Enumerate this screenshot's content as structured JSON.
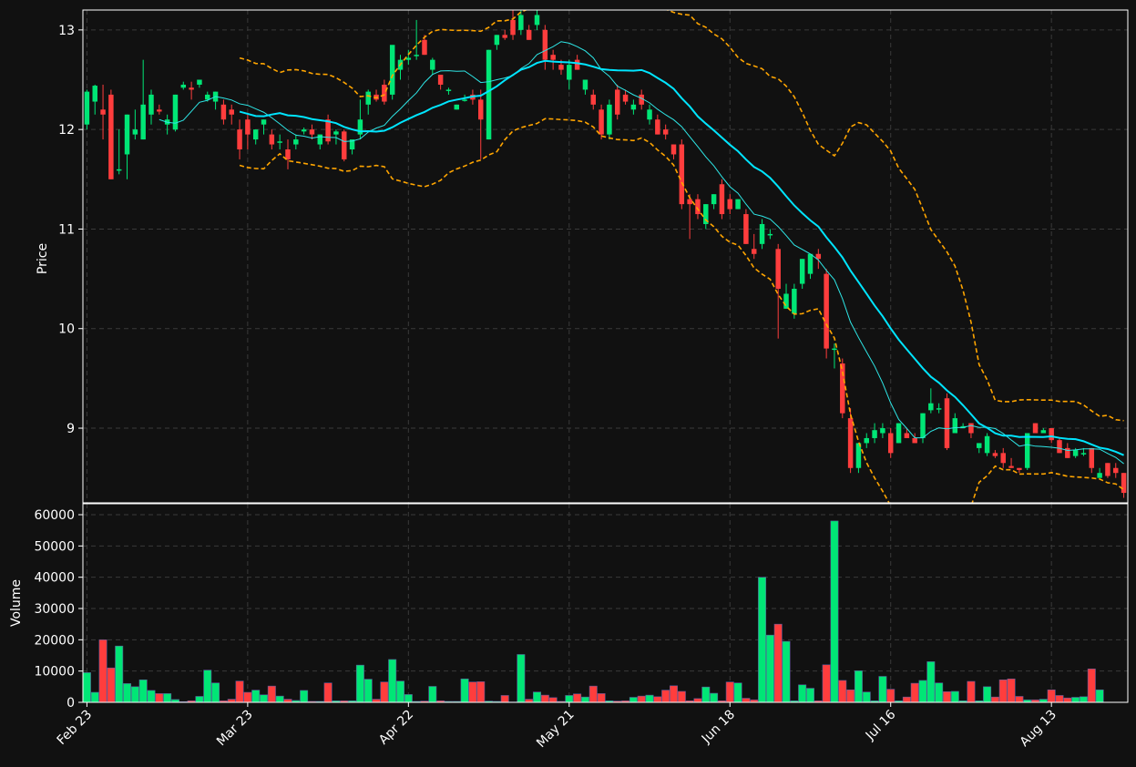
{
  "chart_data": [
    {
      "type": "candlestick",
      "ylabel": "Price",
      "ylim": [
        8.25,
        13.2
      ],
      "y_ticks": [
        "9",
        "10",
        "11",
        "12",
        "13"
      ],
      "x_tick_labels": [
        "Feb 23",
        "Mar 23",
        "Apr 22",
        "May 21",
        "Jun 18",
        "Jul 16",
        "Aug 13"
      ],
      "x_tick_indices": [
        0,
        20,
        40,
        60,
        80,
        100,
        120
      ],
      "grid": true,
      "colors": {
        "up": "#00e676",
        "down": "#ff3d3d",
        "ma_fast": "#2ee6e6",
        "ma_slow": "#00e5ff",
        "bands": "#ffa500",
        "background": "#111111",
        "grid": "#3a3a3a"
      },
      "ohlc": [
        [
          12.05,
          12.4,
          12.0,
          12.38
        ],
        [
          12.28,
          12.45,
          12.15,
          12.44
        ],
        [
          12.2,
          12.45,
          11.9,
          12.15
        ],
        [
          12.35,
          12.4,
          11.5,
          11.5
        ],
        [
          11.6,
          12.0,
          11.55,
          11.6
        ],
        [
          11.75,
          12.15,
          11.5,
          12.15
        ],
        [
          11.95,
          12.2,
          11.9,
          12.0
        ],
        [
          11.9,
          12.7,
          11.9,
          12.25
        ],
        [
          12.15,
          12.4,
          12.05,
          12.35
        ],
        [
          12.2,
          12.25,
          12.15,
          12.18
        ],
        [
          12.05,
          12.15,
          11.95,
          12.1
        ],
        [
          12.0,
          12.35,
          11.98,
          12.35
        ],
        [
          12.42,
          12.48,
          12.4,
          12.45
        ],
        [
          12.42,
          12.48,
          12.3,
          12.4
        ],
        [
          12.45,
          12.5,
          12.42,
          12.5
        ],
        [
          12.3,
          12.38,
          12.28,
          12.35
        ],
        [
          12.28,
          12.38,
          12.2,
          12.38
        ],
        [
          12.25,
          12.3,
          12.05,
          12.1
        ],
        [
          12.2,
          12.25,
          12.05,
          12.15
        ],
        [
          12.0,
          12.1,
          11.7,
          11.8
        ],
        [
          12.1,
          12.15,
          11.8,
          11.95
        ],
        [
          11.9,
          12.0,
          11.85,
          12.0
        ],
        [
          12.05,
          12.1,
          11.95,
          12.1
        ],
        [
          11.95,
          12.0,
          11.8,
          11.85
        ],
        [
          11.88,
          11.95,
          11.8,
          11.88
        ],
        [
          11.8,
          11.9,
          11.6,
          11.7
        ],
        [
          11.85,
          11.95,
          11.8,
          11.9
        ],
        [
          11.98,
          12.02,
          11.95,
          12.0
        ],
        [
          12.0,
          12.05,
          11.9,
          11.95
        ],
        [
          11.85,
          11.95,
          11.8,
          11.95
        ],
        [
          12.1,
          12.15,
          11.85,
          11.88
        ],
        [
          11.95,
          12.0,
          11.85,
          11.98
        ],
        [
          11.98,
          12.0,
          11.68,
          11.7
        ],
        [
          11.8,
          11.85,
          11.75,
          11.9
        ],
        [
          11.95,
          12.3,
          11.9,
          12.1
        ],
        [
          12.25,
          12.4,
          12.15,
          12.38
        ],
        [
          12.35,
          12.4,
          12.28,
          12.3
        ],
        [
          12.45,
          12.5,
          12.25,
          12.28
        ],
        [
          12.35,
          12.7,
          12.3,
          12.85
        ],
        [
          12.6,
          12.75,
          12.5,
          12.7
        ],
        [
          12.7,
          12.8,
          12.65,
          12.72
        ],
        [
          12.75,
          13.1,
          12.7,
          12.75
        ],
        [
          12.9,
          12.95,
          12.75,
          12.75
        ],
        [
          12.6,
          12.72,
          12.55,
          12.7
        ],
        [
          12.55,
          12.55,
          12.4,
          12.45
        ],
        [
          12.4,
          12.42,
          12.35,
          12.4
        ],
        [
          12.2,
          12.25,
          12.2,
          12.25
        ],
        [
          12.3,
          12.35,
          12.28,
          12.3
        ],
        [
          12.35,
          12.4,
          12.25,
          12.3
        ],
        [
          12.3,
          12.4,
          11.7,
          12.1
        ],
        [
          11.9,
          12.8,
          11.9,
          12.8
        ],
        [
          12.85,
          12.95,
          12.8,
          12.95
        ],
        [
          12.95,
          13.0,
          12.9,
          12.92
        ],
        [
          13.1,
          13.2,
          12.9,
          12.95
        ],
        [
          13.0,
          13.2,
          12.95,
          13.15
        ],
        [
          13.0,
          13.05,
          12.9,
          12.9
        ],
        [
          13.05,
          13.2,
          13.0,
          13.15
        ],
        [
          13.0,
          13.05,
          12.6,
          12.7
        ],
        [
          12.75,
          12.8,
          12.6,
          12.7
        ],
        [
          12.65,
          12.7,
          12.55,
          12.6
        ],
        [
          12.5,
          12.7,
          12.4,
          12.65
        ],
        [
          12.7,
          12.75,
          12.6,
          12.6
        ],
        [
          12.4,
          12.5,
          12.35,
          12.5
        ],
        [
          12.35,
          12.4,
          12.2,
          12.25
        ],
        [
          12.2,
          12.25,
          11.9,
          11.95
        ],
        [
          11.95,
          12.3,
          11.9,
          12.25
        ],
        [
          12.4,
          12.45,
          12.1,
          12.15
        ],
        [
          12.35,
          12.4,
          12.25,
          12.28
        ],
        [
          12.2,
          12.3,
          12.15,
          12.25
        ],
        [
          12.35,
          12.4,
          12.2,
          12.25
        ],
        [
          12.1,
          12.25,
          12.05,
          12.2
        ],
        [
          12.1,
          12.15,
          11.95,
          11.95
        ],
        [
          12.0,
          12.05,
          11.9,
          11.95
        ],
        [
          11.85,
          11.85,
          11.7,
          11.75
        ],
        [
          11.85,
          11.9,
          11.2,
          11.25
        ],
        [
          11.3,
          11.35,
          10.9,
          11.25
        ],
        [
          11.3,
          11.35,
          11.1,
          11.15
        ],
        [
          11.05,
          11.25,
          11.0,
          11.25
        ],
        [
          11.25,
          11.35,
          11.2,
          11.35
        ],
        [
          11.45,
          11.5,
          11.1,
          11.15
        ],
        [
          11.3,
          11.35,
          11.15,
          11.2
        ],
        [
          11.2,
          11.3,
          11.2,
          11.3
        ],
        [
          11.15,
          11.2,
          10.85,
          10.85
        ],
        [
          10.8,
          10.95,
          10.7,
          10.75
        ],
        [
          10.85,
          11.1,
          10.8,
          11.05
        ],
        [
          10.95,
          11.0,
          10.9,
          10.95
        ],
        [
          10.8,
          10.85,
          9.9,
          10.4
        ],
        [
          10.2,
          10.45,
          10.2,
          10.35
        ],
        [
          10.15,
          10.45,
          10.1,
          10.4
        ],
        [
          10.45,
          10.7,
          10.4,
          10.7
        ],
        [
          10.55,
          10.75,
          10.5,
          10.75
        ],
        [
          10.75,
          10.8,
          10.6,
          10.7
        ],
        [
          10.55,
          10.6,
          9.7,
          9.8
        ],
        [
          9.8,
          9.85,
          9.6,
          9.8
        ],
        [
          9.65,
          9.7,
          9.1,
          9.15
        ],
        [
          9.1,
          9.2,
          8.55,
          8.6
        ],
        [
          8.6,
          8.85,
          8.55,
          8.85
        ],
        [
          8.85,
          8.95,
          8.8,
          8.9
        ],
        [
          8.9,
          9.05,
          8.85,
          8.98
        ],
        [
          8.95,
          9.05,
          8.9,
          9.0
        ],
        [
          8.95,
          9.0,
          8.7,
          8.75
        ],
        [
          8.85,
          9.05,
          8.85,
          9.05
        ],
        [
          8.95,
          9.0,
          8.9,
          8.9
        ],
        [
          8.9,
          8.95,
          8.85,
          8.85
        ],
        [
          8.9,
          9.15,
          8.85,
          9.15
        ],
        [
          9.18,
          9.4,
          9.15,
          9.25
        ],
        [
          9.2,
          9.25,
          9.15,
          9.2
        ],
        [
          9.3,
          9.35,
          8.78,
          8.8
        ],
        [
          8.95,
          9.15,
          8.95,
          9.1
        ],
        [
          9.0,
          9.05,
          9.0,
          9.02
        ],
        [
          9.05,
          9.05,
          8.9,
          8.95
        ],
        [
          8.8,
          8.85,
          8.75,
          8.85
        ],
        [
          8.75,
          8.95,
          8.72,
          8.92
        ],
        [
          8.75,
          8.78,
          8.7,
          8.72
        ],
        [
          8.75,
          8.8,
          8.6,
          8.65
        ],
        [
          8.62,
          8.7,
          8.6,
          8.6
        ],
        [
          8.6,
          8.6,
          8.55,
          8.58
        ],
        [
          8.6,
          8.95,
          8.58,
          8.95
        ],
        [
          9.05,
          9.05,
          8.95,
          8.95
        ],
        [
          8.95,
          9.0,
          8.95,
          8.98
        ],
        [
          9.0,
          9.0,
          8.85,
          8.88
        ],
        [
          8.88,
          8.9,
          8.75,
          8.75
        ],
        [
          8.8,
          8.85,
          8.7,
          8.7
        ],
        [
          8.72,
          8.8,
          8.7,
          8.78
        ],
        [
          8.75,
          8.8,
          8.72,
          8.75
        ],
        [
          8.8,
          8.8,
          8.55,
          8.6
        ],
        [
          8.5,
          8.6,
          8.5,
          8.55
        ],
        [
          8.65,
          8.65,
          8.5,
          8.52
        ],
        [
          8.6,
          8.65,
          8.5,
          8.55
        ],
        [
          8.55,
          8.55,
          8.3,
          8.35
        ]
      ],
      "ma_fast_period": 10,
      "ma_slow_period": 20,
      "band_period": 20,
      "band_std": 2
    },
    {
      "type": "bar",
      "ylabel": "Volume",
      "ylim": [
        0,
        63500
      ],
      "y_ticks": [
        "0",
        "10000",
        "20000",
        "30000",
        "40000",
        "50000",
        "60000"
      ],
      "grid": true,
      "values": [
        9500,
        3200,
        20000,
        11000,
        18000,
        6000,
        5000,
        7200,
        3800,
        2800,
        2800,
        900,
        200,
        500,
        1900,
        10300,
        6200,
        500,
        1000,
        6800,
        3200,
        3900,
        2400,
        5200,
        2000,
        1000,
        600,
        3800,
        300,
        300,
        6200,
        500,
        500,
        500,
        11900,
        7400,
        1000,
        6500,
        13700,
        6800,
        2500,
        300,
        400,
        5100,
        500,
        300,
        300,
        7500,
        6500,
        6600,
        400,
        300,
        2200,
        100,
        15300,
        1000,
        3300,
        2300,
        1500,
        300,
        2200,
        2700,
        1700,
        5200,
        2800,
        500,
        400,
        500,
        1600,
        2000,
        2300,
        1800,
        3900,
        5300,
        3500,
        500,
        1200,
        4900,
        2900,
        500,
        6500,
        6200,
        1300,
        800,
        40000,
        21500,
        25000,
        19500,
        500,
        5600,
        4500,
        500,
        12000,
        58000,
        7000,
        4000,
        10100,
        3300,
        500,
        8300,
        4200,
        500,
        1700,
        6100,
        7000,
        13000,
        6200,
        3400,
        3500,
        500,
        6700,
        500,
        5000,
        1700,
        7200,
        7500,
        1900,
        800,
        800,
        1000,
        4000,
        2200,
        1400,
        1600,
        1800,
        10700,
        4000
      ]
    }
  ]
}
